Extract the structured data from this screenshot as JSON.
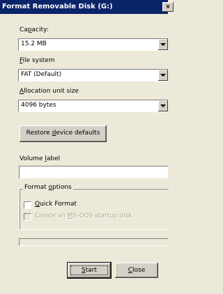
{
  "window": {
    "title": "Format Removable Disk (G:)",
    "close_glyph": "×"
  },
  "capacity": {
    "label_pre": "Ca",
    "label_accel": "p",
    "label_post": "acity:",
    "value": "15.2 MB"
  },
  "file_system": {
    "label_accel": "F",
    "label_post": "ile system",
    "value": "FAT (Default)"
  },
  "allocation_unit": {
    "label_accel": "A",
    "label_post": "llocation unit size",
    "value": "4096 bytes"
  },
  "restore_button": {
    "label_pre": "Restore ",
    "label_accel": "d",
    "label_post": "evice defaults"
  },
  "volume_label": {
    "label_pre": "Volume ",
    "label_accel": "l",
    "label_post": "abel",
    "value": ""
  },
  "format_options": {
    "title_pre": "Format ",
    "title_accel": "o",
    "title_post": "ptions",
    "quick_format": {
      "label_accel": "Q",
      "label_post": "uick Format",
      "checked": false
    },
    "msdos": {
      "label_pre": "Create an ",
      "label_accel": "M",
      "label_post": "S-DOS startup disk",
      "checked": false,
      "enabled": false
    }
  },
  "progress": {
    "value": 0
  },
  "buttons": {
    "start": {
      "label_accel": "S",
      "label_post": "tart"
    },
    "close": {
      "label_accel": "C",
      "label_post": "lose"
    }
  }
}
